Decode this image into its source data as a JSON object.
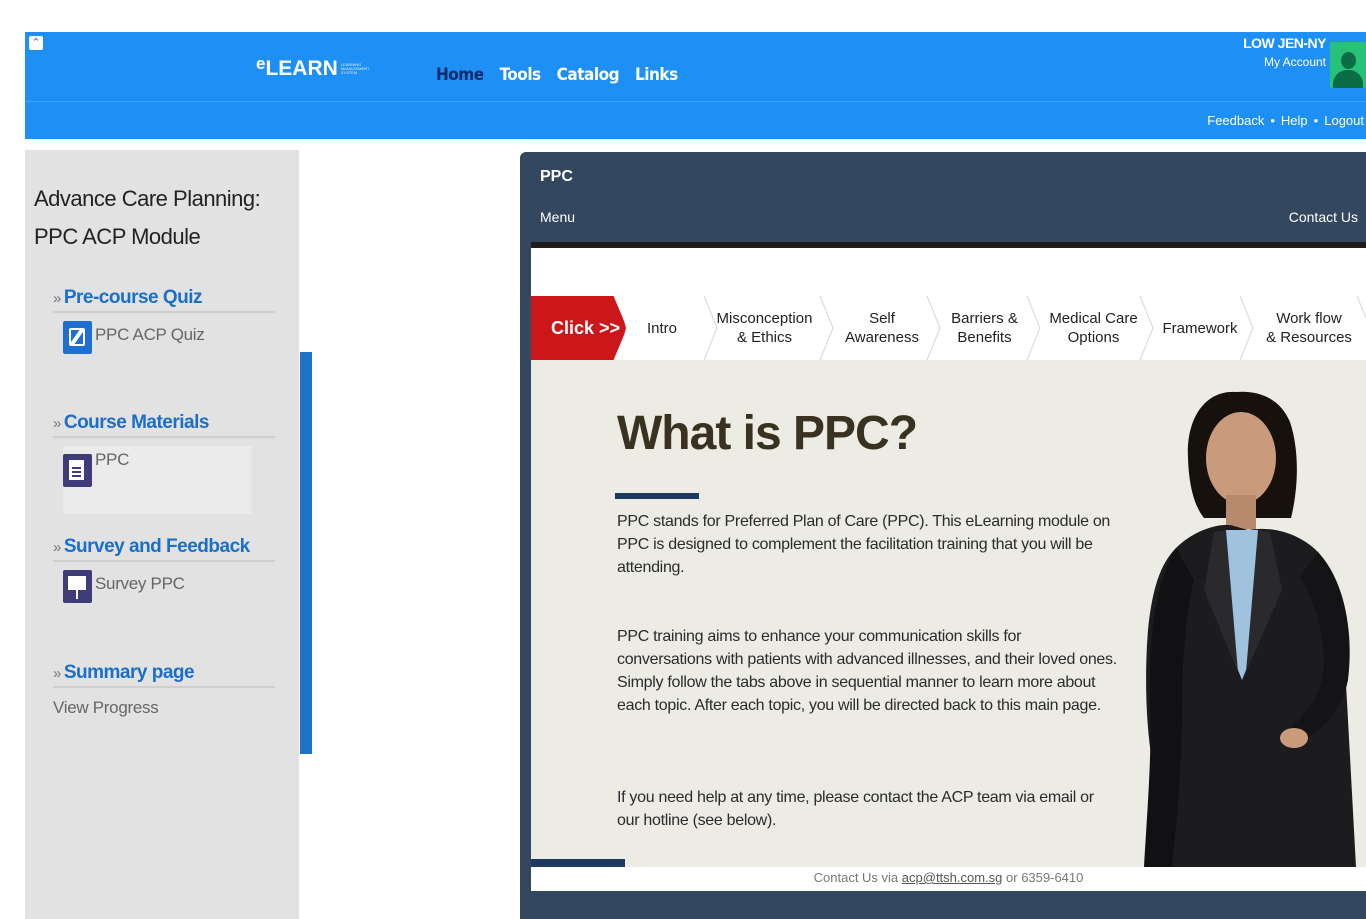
{
  "header": {
    "collapse_icon": "double-chevron-up-icon",
    "logo_main": "LEARN",
    "logo_prefix": "e",
    "logo_sub": "LEARNING MANAGEMENT SYSTEM",
    "nav": [
      "Home",
      "Tools",
      "Catalog",
      "Links"
    ],
    "active_nav": "Home",
    "user_name": "LOW JEN-NY",
    "account_link": "My Account",
    "sublinks": [
      "Feedback",
      "Help",
      "Logout"
    ],
    "accent_color": "#1e90f5"
  },
  "sidebar": {
    "course_title_1": "Advance Care Planning:",
    "course_title_2": "PPC ACP Module",
    "sections": [
      {
        "title": "Pre-course Quiz",
        "item": "PPC ACP Quiz",
        "icon": "quiz-edit-icon"
      },
      {
        "title": "Course Materials",
        "item": "PPC",
        "icon": "document-icon"
      },
      {
        "title": "Survey and Feedback",
        "item": "Survey PPC",
        "icon": "survey-board-icon"
      },
      {
        "title": "Summary page",
        "item": "View Progress"
      }
    ]
  },
  "player": {
    "title": "PPC",
    "menu": "Menu",
    "contact": "Contact Us",
    "click_tab": "Click >>",
    "tabs": [
      {
        "l1": "Intro",
        "l2": ""
      },
      {
        "l1": "Misconception",
        "l2": "& Ethics"
      },
      {
        "l1": "Self",
        "l2": "Awareness"
      },
      {
        "l1": "Barriers &",
        "l2": "Benefits"
      },
      {
        "l1": "Medical Care",
        "l2": "Options"
      },
      {
        "l1": "Framework",
        "l2": ""
      },
      {
        "l1": "Work flow",
        "l2": "& Resources"
      }
    ],
    "heading": "What is PPC?",
    "para1": "PPC stands for Preferred Plan of Care (PPC). This eLearning module on PPC is designed to complement the facilitation training that you will be attending.",
    "para2": "PPC training aims to enhance your communication skills  for conversations  with patients with advanced illnesses, and their loved ones. Simply follow the tabs above in sequential manner to learn more about each topic. After each topic, you will be directed back to this main page.",
    "para3": "If you need help at any time, please contact the ACP team via email or our hotline (see below).",
    "footer_prefix": "Contact  Us via ",
    "footer_email": "acp@ttsh.com.sg",
    "footer_suffix": " or 6359-6410"
  }
}
